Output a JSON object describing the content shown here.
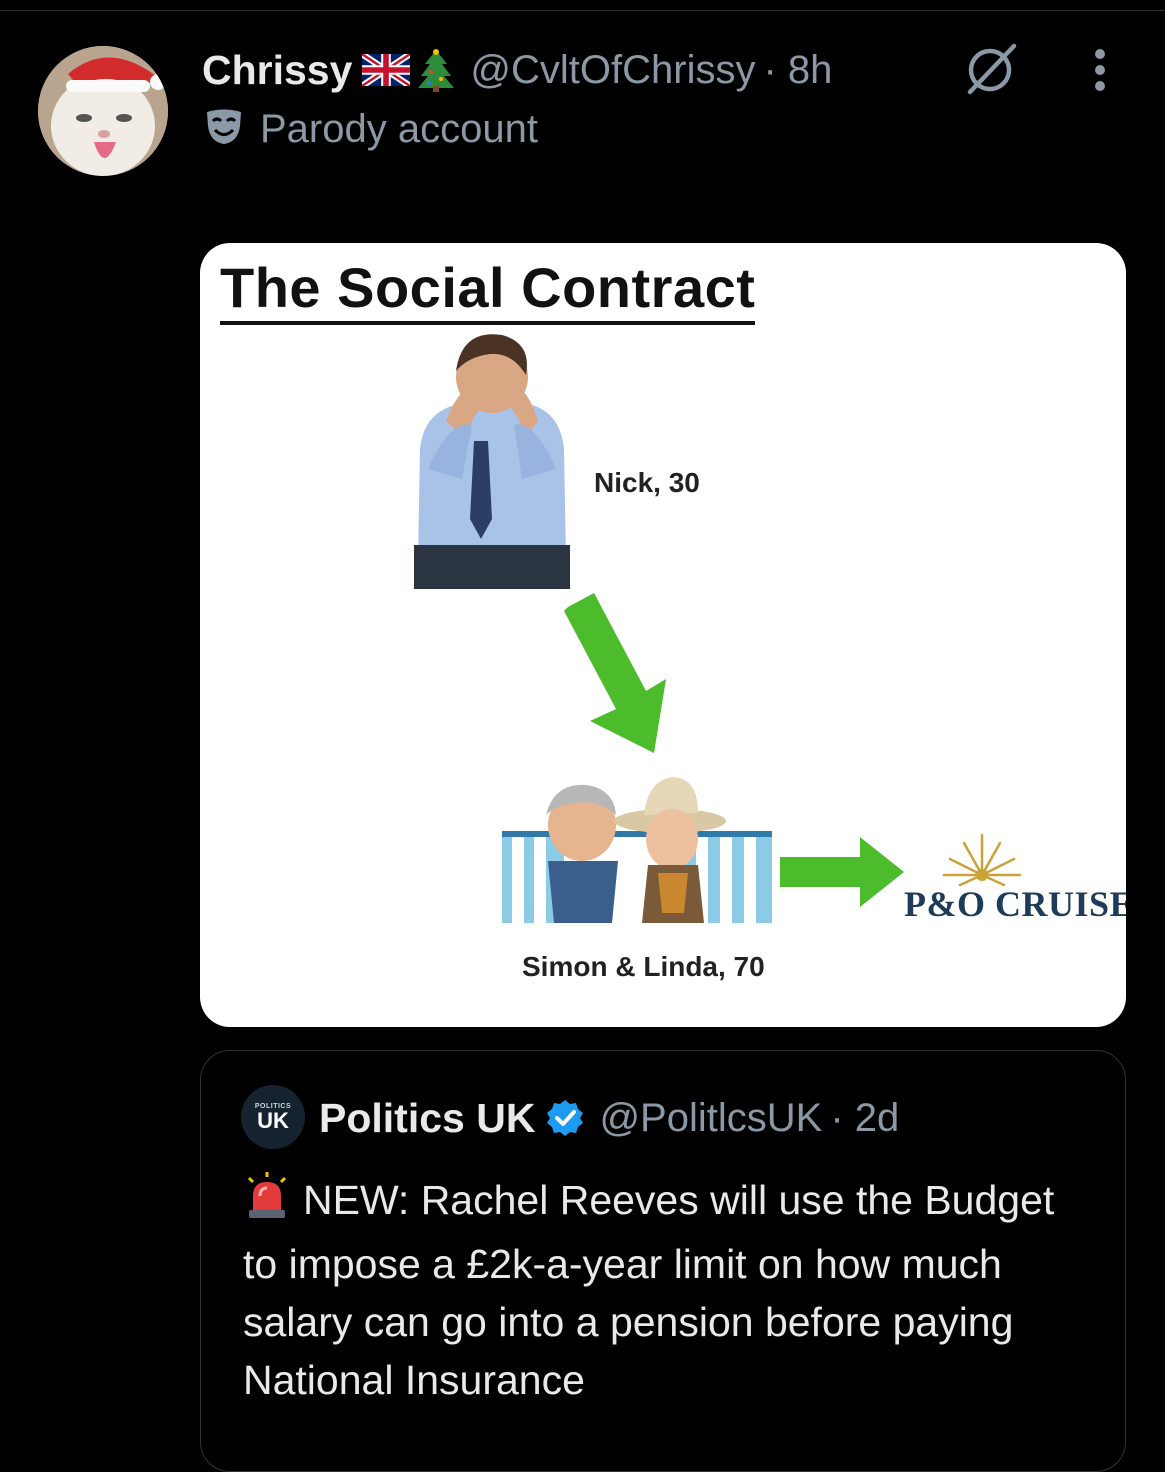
{
  "post": {
    "author": {
      "display_name": "Chrissy",
      "handle": "@CvltOfChrissy",
      "timestamp": "· 8h",
      "label": "Parody account",
      "badges": [
        "uk-flag-icon",
        "christmas-tree-icon"
      ]
    },
    "media": {
      "title": "The Social Contract",
      "nick_label": "Nick, 30",
      "couple_label": "Simon & Linda, 70",
      "brand": "P&O CRUISES",
      "arrow_color": "#4cbb2c"
    }
  },
  "quote": {
    "author": {
      "display_name": "Politics UK",
      "handle": "@PolitlcsUK",
      "timestamp": "· 2d",
      "avatar_small": "POLITICS",
      "avatar_big": "UK"
    },
    "text": "NEW: Rachel Reeves will use the Budget to impose a £2k-a-year limit on how much salary can go into a pension before paying National Insurance",
    "leading_icon": "siren-icon"
  },
  "colors": {
    "background": "#000000",
    "text_primary": "#e7e9ea",
    "text_secondary": "#8b98a5",
    "verified": "#1d9bf0",
    "border": "#2f3336"
  }
}
